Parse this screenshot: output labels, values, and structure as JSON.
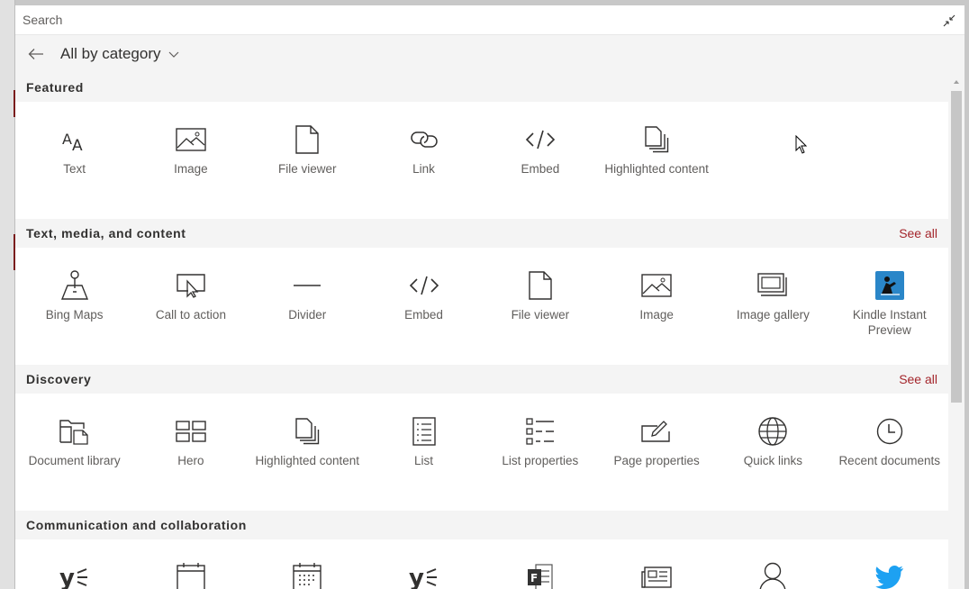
{
  "search": {
    "placeholder": "Search",
    "value": ""
  },
  "nav": {
    "category_label": "All by category"
  },
  "colors": {
    "accent": "#a4262c",
    "twitter": "#1da1f2",
    "kindle": "#2a86c8",
    "forms": "#31752f"
  },
  "sections": [
    {
      "title": "Featured",
      "see_all": "",
      "items": [
        {
          "label": "Text",
          "icon": "text-icon"
        },
        {
          "label": "Image",
          "icon": "image-icon"
        },
        {
          "label": "File viewer",
          "icon": "file-icon"
        },
        {
          "label": "Link",
          "icon": "link-icon"
        },
        {
          "label": "Embed",
          "icon": "embed-icon"
        },
        {
          "label": "Highlighted content",
          "icon": "highlighted-content-icon"
        }
      ]
    },
    {
      "title": "Text, media, and content",
      "see_all": "See all",
      "items": [
        {
          "label": "Bing Maps",
          "icon": "map-pin-icon"
        },
        {
          "label": "Call to action",
          "icon": "call-to-action-icon"
        },
        {
          "label": "Divider",
          "icon": "divider-icon"
        },
        {
          "label": "Embed",
          "icon": "embed-icon"
        },
        {
          "label": "File viewer",
          "icon": "file-icon"
        },
        {
          "label": "Image",
          "icon": "image-icon"
        },
        {
          "label": "Image gallery",
          "icon": "image-gallery-icon"
        },
        {
          "label": "Kindle Instant Preview",
          "icon": "kindle-icon"
        }
      ]
    },
    {
      "title": "Discovery",
      "see_all": "See all",
      "items": [
        {
          "label": "Document library",
          "icon": "document-library-icon"
        },
        {
          "label": "Hero",
          "icon": "hero-icon"
        },
        {
          "label": "Highlighted content",
          "icon": "highlighted-content-icon"
        },
        {
          "label": "List",
          "icon": "list-icon"
        },
        {
          "label": "List properties",
          "icon": "list-properties-icon"
        },
        {
          "label": "Page properties",
          "icon": "page-properties-icon"
        },
        {
          "label": "Quick links",
          "icon": "globe-icon"
        },
        {
          "label": "Recent documents",
          "icon": "clock-icon"
        }
      ]
    },
    {
      "title": "Communication and collaboration",
      "see_all": "",
      "items": [
        {
          "label": "",
          "icon": "yammer-icon"
        },
        {
          "label": "",
          "icon": "calendar-icon"
        },
        {
          "label": "",
          "icon": "events-icon"
        },
        {
          "label": "",
          "icon": "yammer-icon"
        },
        {
          "label": "",
          "icon": "forms-icon"
        },
        {
          "label": "",
          "icon": "news-icon"
        },
        {
          "label": "",
          "icon": "person-icon"
        },
        {
          "label": "",
          "icon": "twitter-icon"
        }
      ]
    }
  ]
}
